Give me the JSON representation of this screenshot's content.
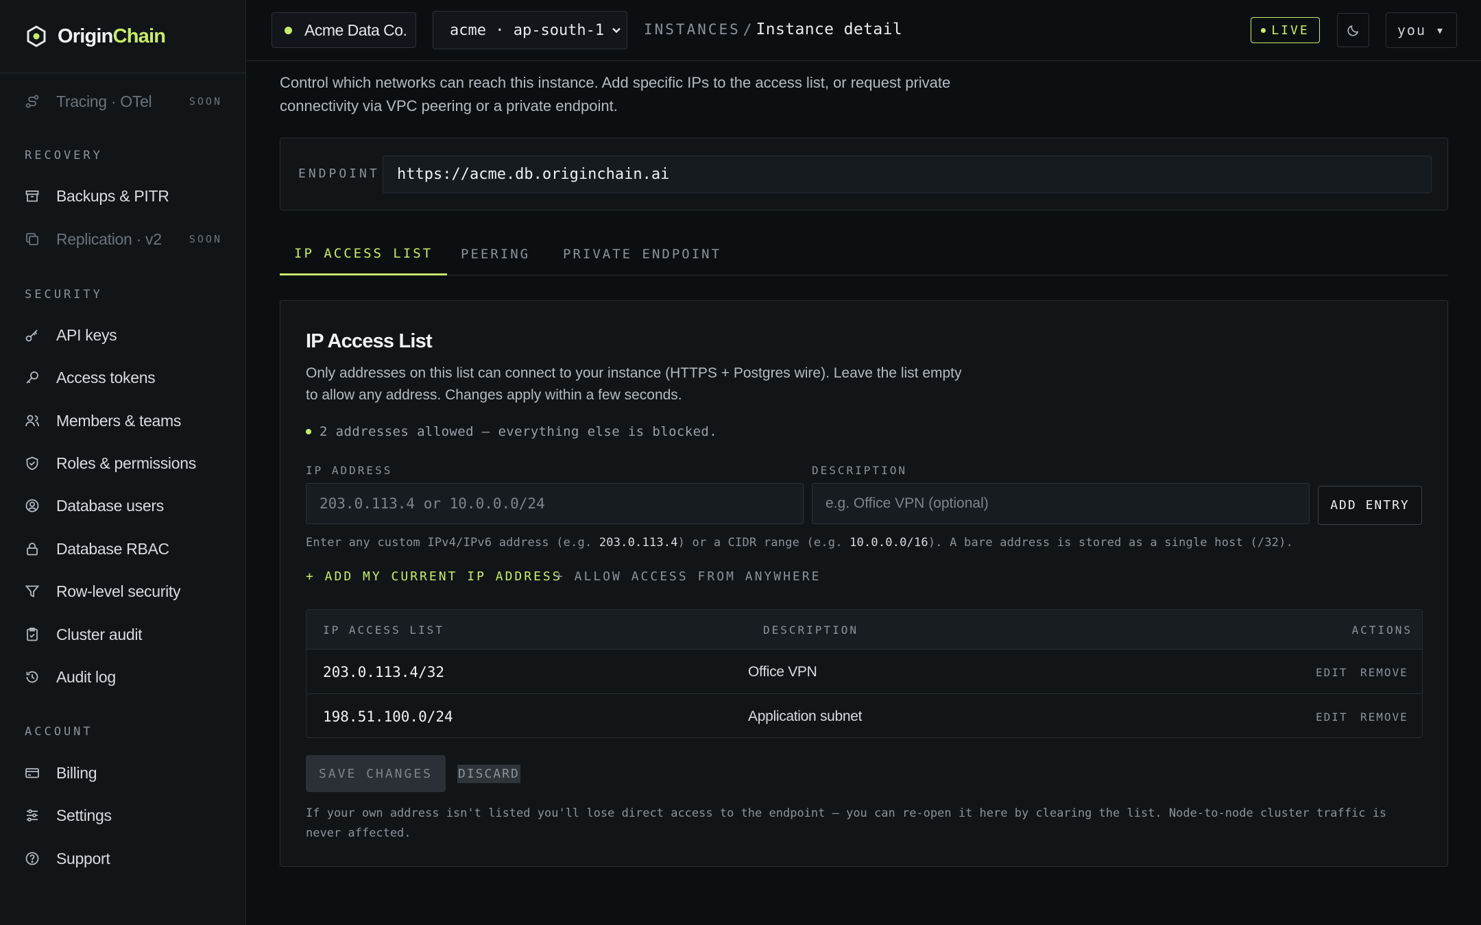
{
  "brand": {
    "name_part1": "Origin",
    "name_part2": "Chain",
    "accent": "#c9ec6a"
  },
  "sidebar": {
    "top_item": {
      "label": "Tracing · OTel",
      "badge": "SOON",
      "icon": "trace-icon"
    },
    "sections": [
      {
        "title": "RECOVERY"
      },
      {
        "title": "SECURITY"
      },
      {
        "title": "ACCOUNT"
      }
    ],
    "recovery": [
      {
        "label": "Backups & PITR",
        "icon": "archive-icon"
      },
      {
        "label": "Replication · v2",
        "badge": "SOON",
        "icon": "copy-icon"
      }
    ],
    "security": [
      {
        "label": "API keys",
        "icon": "key-icon"
      },
      {
        "label": "Access tokens",
        "icon": "token-icon"
      },
      {
        "label": "Members & teams",
        "icon": "users-icon"
      },
      {
        "label": "Roles & permissions",
        "icon": "shield-icon"
      },
      {
        "label": "Database users",
        "icon": "user-circle-icon"
      },
      {
        "label": "Database RBAC",
        "icon": "lock-icon"
      },
      {
        "label": "Row-level security",
        "icon": "filter-icon"
      },
      {
        "label": "Cluster audit",
        "icon": "clipboard-icon"
      },
      {
        "label": "Audit log",
        "icon": "history-icon"
      }
    ],
    "account": [
      {
        "label": "Billing",
        "icon": "card-icon"
      },
      {
        "label": "Settings",
        "icon": "sliders-icon"
      },
      {
        "label": "Support",
        "icon": "help-icon"
      }
    ]
  },
  "topbar": {
    "org": "Acme Data Co.",
    "region": "acme · ap-south-1",
    "crumb_parent": "INSTANCES",
    "crumb_sep": "/",
    "crumb_current": "Instance detail",
    "status": "LIVE",
    "user": "you ▾"
  },
  "intro": "Control which networks can reach this instance. Add specific IPs to the access list, or request private connectivity via VPC peering or a private endpoint.",
  "endpoint": {
    "label": "ENDPOINT",
    "value": "https://acme.db.originchain.ai"
  },
  "tabs": [
    "IP ACCESS LIST",
    "PEERING",
    "PRIVATE ENDPOINT"
  ],
  "panel": {
    "title": "IP Access List",
    "description": "Only addresses on this list can connect to your instance (HTTPS + Postgres wire). Leave the list empty to allow any address. Changes apply within a few seconds.",
    "status": "2 addresses allowed — everything else is blocked.",
    "ip_label": "IP ADDRESS",
    "ip_placeholder": "203.0.113.4 or 10.0.0.0/24",
    "desc_label": "DESCRIPTION",
    "desc_placeholder": "e.g. Office VPN (optional)",
    "add_button": "ADD ENTRY",
    "hint_pre": "Enter any custom IPv4/IPv6 address (e.g. ",
    "hint_ex1": "203.0.113.4",
    "hint_mid": ") or a CIDR range (e.g. ",
    "hint_ex2": "10.0.0.0/16",
    "hint_post": "). A bare address is stored as a single host (/32).",
    "add_current_ip": "+ ADD MY CURRENT IP ADDRESS",
    "allow_anywhere": "+ ALLOW ACCESS FROM ANYWHERE",
    "table": {
      "headers": [
        "IP ACCESS LIST",
        "DESCRIPTION",
        "ACTIONS"
      ],
      "rows": [
        {
          "ip": "203.0.113.4/32",
          "description": "Office VPN",
          "edit": "EDIT",
          "remove": "REMOVE"
        },
        {
          "ip": "198.51.100.0/24",
          "description": "Application subnet",
          "edit": "EDIT",
          "remove": "REMOVE"
        }
      ]
    },
    "save_button": "SAVE CHANGES",
    "discard_button": "DISCARD",
    "footnote": "If your own address isn't listed you'll lose direct access to the endpoint — you can re-open it here by clearing the list. Node-to-node cluster traffic is never affected."
  }
}
